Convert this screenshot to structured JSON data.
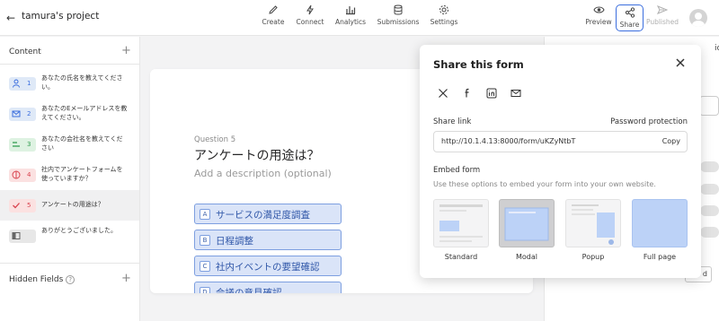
{
  "topbar": {
    "project_name": "tamura's project",
    "nav": [
      {
        "label": "Create",
        "icon": "pencil-icon"
      },
      {
        "label": "Connect",
        "icon": "bolt-icon"
      },
      {
        "label": "Analytics",
        "icon": "bar-chart-icon"
      },
      {
        "label": "Submissions",
        "icon": "database-icon"
      },
      {
        "label": "Settings",
        "icon": "gear-icon"
      }
    ],
    "preview_label": "Preview",
    "share_label": "Share",
    "published_label": "Published"
  },
  "sidebar": {
    "content_label": "Content",
    "hidden_fields_label": "Hidden Fields",
    "questions": [
      {
        "num": "1",
        "icon": "person-icon",
        "text": "あなたの氏名を教えてください。",
        "color": "#dfe9f7"
      },
      {
        "num": "2",
        "icon": "mail-icon",
        "text": "あなたのEメールアドレスを教えてください。",
        "color": "#dfe9f7"
      },
      {
        "num": "3",
        "icon": "short-text-icon",
        "text": "あなたの会社名を教えてください",
        "color": "#def2e2"
      },
      {
        "num": "4",
        "icon": "yes-no-icon",
        "text": "社内でアンケートフォームを使っていますか？",
        "color": "#fbe1e1"
      },
      {
        "num": "5",
        "icon": "check-icon",
        "text": "アンケートの用途は？",
        "color": "#fbe1e1"
      },
      {
        "num": "",
        "icon": "ending-icon",
        "text": "ありがとうございました。",
        "color": "#e7e7e7"
      }
    ]
  },
  "canvas": {
    "question_label": "Question 5",
    "title": "アンケートの用途は？",
    "description_placeholder": "Add a description (optional)",
    "choices": [
      {
        "key": "A",
        "text": "サービスの満足度調査"
      },
      {
        "key": "B",
        "text": "日程調整"
      },
      {
        "key": "C",
        "text": "社内イベントの要望確認"
      },
      {
        "key": "D",
        "text": "会議の意見確認"
      }
    ]
  },
  "right_panel": {
    "fragment_text": "ic",
    "dropdown_text": "d"
  },
  "share_popover": {
    "title": "Share this form",
    "socials": [
      "x-icon",
      "facebook-icon",
      "linkedin-icon",
      "mail-icon"
    ],
    "share_link_label": "Share link",
    "password_label": "Password protection",
    "url": "http://10.1.4.13:8000/form/uKZyNtbT",
    "copy_label": "Copy",
    "embed_title": "Embed form",
    "embed_desc": "Use these options to embed your form into your own website.",
    "embed_options": [
      "Standard",
      "Modal",
      "Popup",
      "Full page"
    ]
  },
  "colors": {
    "accent": "#3b6ede",
    "choice_bg": "#dae4f8",
    "choice_text": "#2f56a8"
  }
}
